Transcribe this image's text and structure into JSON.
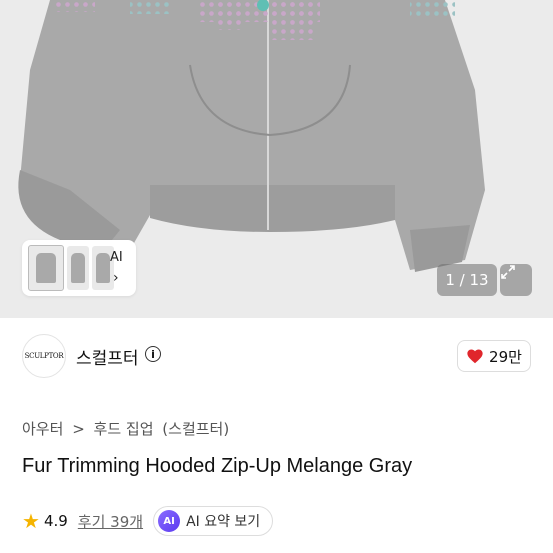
{
  "gallery": {
    "ai_label": "AI",
    "chevron": "›",
    "counter": "1 / 13",
    "thumbnails": [
      "thumb-front",
      "thumb-side",
      "thumb-model"
    ]
  },
  "shop": {
    "logo_text": "SCULPTOR",
    "name": "스컬프터",
    "info_glyph": "i",
    "likes": "29만",
    "heart_color": "#e0262c"
  },
  "breadcrumb": {
    "items": [
      "아우터",
      ">",
      "후드 집업",
      "(스컬프터)"
    ]
  },
  "product": {
    "title": "Fur Trimming Hooded Zip-Up Melange Gray",
    "rating": "4.9",
    "reviews": "후기 39개",
    "ai_badge": "AI",
    "ai_summary": "AI 요약 보기",
    "star_color": "#f5b400"
  }
}
